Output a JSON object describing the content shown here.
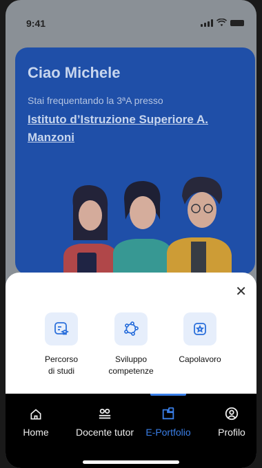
{
  "status": {
    "time": "9:41"
  },
  "hero": {
    "greeting": "Ciao Michele",
    "subtitle": "Stai frequentando la 3ªA presso",
    "school": "Istituto d’Istruzione Superiore A. Manzoni"
  },
  "sheet": {
    "options": [
      {
        "label_line1": "Percorso",
        "label_line2": "di studi",
        "icon": "study-path-icon"
      },
      {
        "label_line1": "Sviluppo",
        "label_line2": "competenze",
        "icon": "skills-graph-icon"
      },
      {
        "label_line1": "Capolavoro",
        "label_line2": "",
        "icon": "star-badge-icon"
      }
    ],
    "close_icon": "close-icon",
    "icon_color": "#2a6fdb",
    "icon_bg": "#e6eefb"
  },
  "nav": {
    "items": [
      {
        "label": "Home",
        "icon": "home-icon"
      },
      {
        "label": "Docente tutor",
        "icon": "tutor-icon"
      },
      {
        "label": "E-Portfolio",
        "icon": "portfolio-icon",
        "active": true
      },
      {
        "label": "Profilo",
        "icon": "profile-icon"
      }
    ],
    "active_color": "#3a7fe8"
  },
  "colors": {
    "hero_bg": "#1f4fa8",
    "nav_bg": "#000000"
  }
}
